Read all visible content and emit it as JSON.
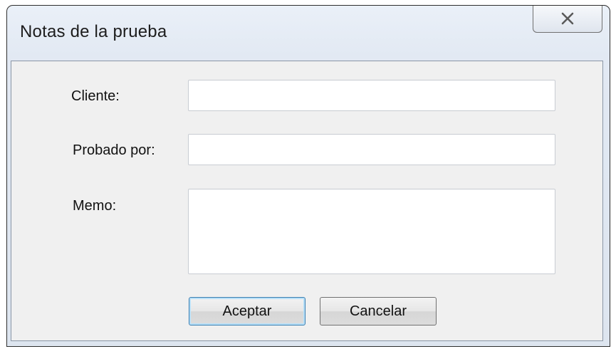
{
  "window": {
    "title": "Notas de la prueba",
    "close_icon": "close-icon"
  },
  "form": {
    "cliente_label": "Cliente:",
    "cliente_value": "",
    "probado_label": "Probado por:",
    "probado_value": "",
    "memo_label": "Memo:",
    "memo_value": ""
  },
  "buttons": {
    "ok_label": "Aceptar",
    "cancel_label": "Cancelar"
  },
  "colors": {
    "frame": "#dde5ef",
    "client": "#f0f0f0",
    "default_button_border": "#3c7fb1"
  }
}
